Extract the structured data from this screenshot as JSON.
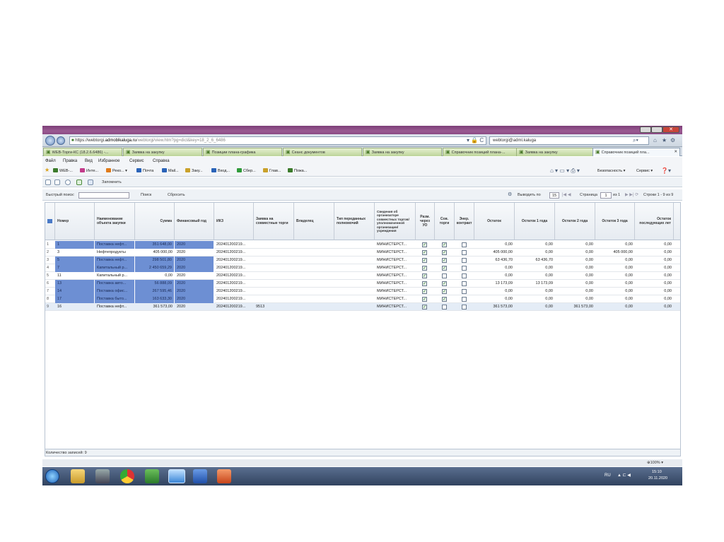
{
  "browser": {
    "address_url": "https://webtorgi.admoblkaluga.ru/webtorgi/view.htm?pg=dict&key=18_2_6_6486",
    "address_domain": "admoblkaluga.ru",
    "address_prefix": "https://webtorgi.",
    "address_suffix": "/webtorgi/view.htm?pg=dict&key=18_2_6_6486",
    "search_text": "webtorgi@adml.kaluga",
    "zoom": "100%",
    "window_close": "✕"
  },
  "tabs": [
    {
      "label": "WEB-Торги-КС (18.2.6.6486) -..."
    },
    {
      "label": "Заявка на закупку"
    },
    {
      "label": "Позиции плана-графика"
    },
    {
      "label": "Сеанс документов"
    },
    {
      "label": "Заявка на закупку"
    },
    {
      "label": "Справочник позиций плана-..."
    },
    {
      "label": "Заявка на закупку"
    },
    {
      "label": "Справочник позиций пла..."
    }
  ],
  "menu": [
    "Файл",
    "Правка",
    "Вид",
    "Избранное",
    "Сервис",
    "Справка"
  ],
  "favorites": [
    {
      "label": "WEB-...",
      "color": "#3b7a2b"
    },
    {
      "label": "Инте...",
      "color": "#c23a8a"
    },
    {
      "label": "Реко... ▾",
      "color": "#e07a1a"
    },
    {
      "label": "Почта",
      "color": "#2a63b8"
    },
    {
      "label": "Mail...",
      "color": "#2a63b8"
    },
    {
      "label": "Заку...",
      "color": "#caa12a"
    },
    {
      "label": "Вход...",
      "color": "#2a63b8"
    },
    {
      "label": "Сбер...",
      "color": "#2f9a3a"
    },
    {
      "label": "Глав...",
      "color": "#caa12a"
    },
    {
      "label": "Пожа...",
      "color": "#3b7a2b"
    }
  ],
  "command_bar": {
    "security": "Безопасность ▾",
    "service": "Сервис ▾"
  },
  "app_toolbar": {
    "remember_label": "Запомнить"
  },
  "search": {
    "label": "Быстрый поиск:",
    "value": "",
    "find": "Поиск",
    "reset": "Сбросить"
  },
  "pager": {
    "show_label": "Выводить по",
    "per_page": "15",
    "page_label": "Страница",
    "page": "1",
    "of_pages": "из 1",
    "rows_info": "Строки 1 - 9 из 9"
  },
  "columns": [
    "Номер",
    "Наименование объекта закупки",
    "Сумма",
    "Финансовый год",
    "ИКЗ",
    "Заявка на совместные торги",
    "Владелец",
    "Тип переданных полномочий",
    "Сведения об организаторе совместных торгов/уполномоченной организации/учреждения",
    "Разм. через УО",
    "Сов. торги",
    "Энер. контракт",
    "Остаток",
    "Остаток 1 года",
    "Остаток 2 года",
    "Остаток 3 года",
    "Остаток последующих лет"
  ],
  "rows": [
    {
      "n": "1",
      "num": "1",
      "name": "Поставка нефт...",
      "sum": "351 648,00",
      "year": "2020",
      "ikz": "202401200219...",
      "joint": "",
      "owner": "",
      "type": "",
      "org": "МИНИСТЕРСТ...",
      "uo": true,
      "sov": true,
      "en": false,
      "ost": "0,00",
      "o1": "0,00",
      "o2": "0,00",
      "o3": "0,00",
      "op": "0,00",
      "hl": true
    },
    {
      "n": "2",
      "num": "3",
      "name": "Нефтепродукты",
      "sum": "405 000,00",
      "year": "2020",
      "ikz": "202401200219...",
      "joint": "",
      "owner": "",
      "type": "",
      "org": "МИНИСТЕРСТ...",
      "uo": true,
      "sov": true,
      "en": false,
      "ost": "405 000,00",
      "o1": "0,00",
      "o2": "0,00",
      "o3": "405 000,00",
      "op": "0,00",
      "hl": false
    },
    {
      "n": "3",
      "num": "5",
      "name": "Поставка нефт...",
      "sum": "298 501,80",
      "year": "2020",
      "ikz": "202401200219...",
      "joint": "",
      "owner": "",
      "type": "",
      "org": "МИНИСТЕРСТ...",
      "uo": true,
      "sov": true,
      "en": false,
      "ost": "63 436,70",
      "o1": "63 436,70",
      "o2": "0,00",
      "o3": "0,00",
      "op": "0,00",
      "hl": true
    },
    {
      "n": "4",
      "num": "7",
      "name": "Капитальный р...",
      "sum": "2 450 659,29",
      "year": "2020",
      "ikz": "202401200219...",
      "joint": "",
      "owner": "",
      "type": "",
      "org": "МИНИСТЕРСТ...",
      "uo": true,
      "sov": true,
      "en": false,
      "ost": "0,00",
      "o1": "0,00",
      "o2": "0,00",
      "o3": "0,00",
      "op": "0,00",
      "hl": true
    },
    {
      "n": "5",
      "num": "11",
      "name": "Капитальный р...",
      "sum": "0,00",
      "year": "2020",
      "ikz": "202401200219...",
      "joint": "",
      "owner": "",
      "type": "",
      "org": "МИНИСТЕРСТ...",
      "uo": true,
      "sov": false,
      "en": false,
      "ost": "0,00",
      "o1": "0,00",
      "o2": "0,00",
      "o3": "0,00",
      "op": "0,00",
      "hl": false
    },
    {
      "n": "6",
      "num": "13",
      "name": "Поставка авто...",
      "sum": "56 888,09",
      "year": "2020",
      "ikz": "202401200219...",
      "joint": "",
      "owner": "",
      "type": "",
      "org": "МИНИСТЕРСТ...",
      "uo": true,
      "sov": true,
      "en": false,
      "ost": "13 173,09",
      "o1": "13 173,09",
      "o2": "0,00",
      "o3": "0,00",
      "op": "0,00",
      "hl": true
    },
    {
      "n": "7",
      "num": "14",
      "name": "Поставка офис...",
      "sum": "267 595,46",
      "year": "2020",
      "ikz": "202401200219...",
      "joint": "",
      "owner": "",
      "type": "",
      "org": "МИНИСТЕРСТ...",
      "uo": true,
      "sov": true,
      "en": false,
      "ost": "0,00",
      "o1": "0,00",
      "o2": "0,00",
      "o3": "0,00",
      "op": "0,00",
      "hl": true
    },
    {
      "n": "8",
      "num": "17",
      "name": "Поставка быто...",
      "sum": "163 633,30",
      "year": "2020",
      "ikz": "202401200219...",
      "joint": "",
      "owner": "",
      "type": "",
      "org": "МИНИСТЕРСТ...",
      "uo": true,
      "sov": true,
      "en": false,
      "ost": "0,00",
      "o1": "0,00",
      "o2": "0,00",
      "o3": "0,00",
      "op": "0,00",
      "hl": true
    },
    {
      "n": "9",
      "num": "16",
      "name": "Поставка нефт...",
      "sum": "361 573,00",
      "year": "2020",
      "ikz": "202401200219...",
      "joint": "9513",
      "owner": "",
      "type": "",
      "org": "МИНИСТЕРСТ...",
      "uo": true,
      "sov": false,
      "en": false,
      "ost": "361 573,00",
      "o1": "0,00",
      "o2": "361 573,00",
      "o3": "0,00",
      "op": "0,00",
      "hl": false
    }
  ],
  "footer": {
    "count_label": "Количество записей: 9"
  },
  "taskbar": {
    "lang": "RU",
    "time": "15:10",
    "date": "20.11.2020"
  }
}
